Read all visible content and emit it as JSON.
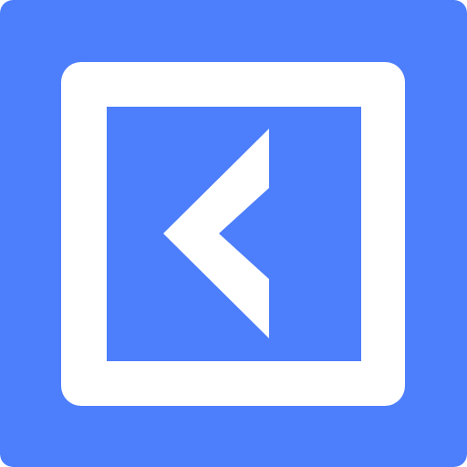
{
  "icon": {
    "name": "chevron-left-icon",
    "direction": "left"
  },
  "colors": {
    "background": "#4d7efc",
    "frame": "#ffffff",
    "inner": "#4d7efc",
    "chevron": "#ffffff"
  }
}
